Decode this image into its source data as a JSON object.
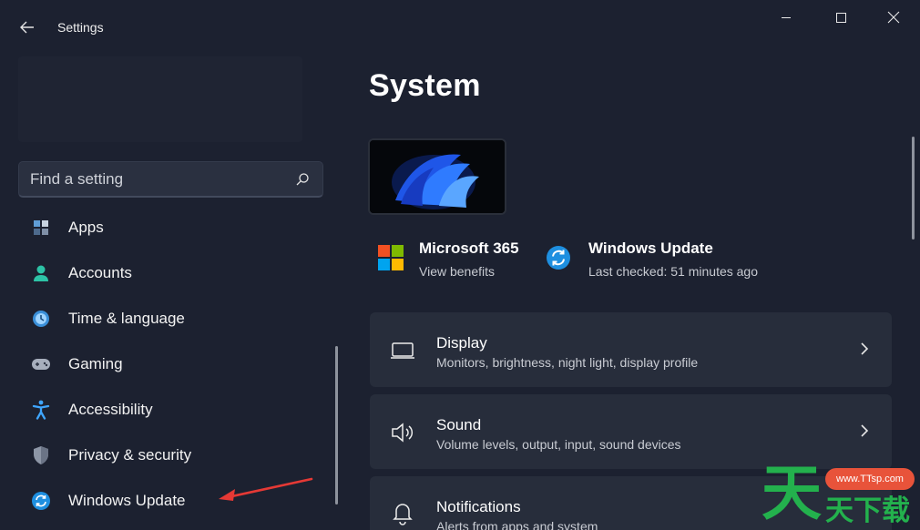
{
  "window": {
    "title": "Settings"
  },
  "search": {
    "placeholder": "Find a setting"
  },
  "sidebar": {
    "items": [
      {
        "label": "Apps",
        "icon": "apps-icon"
      },
      {
        "label": "Accounts",
        "icon": "accounts-icon"
      },
      {
        "label": "Time & language",
        "icon": "time-language-icon"
      },
      {
        "label": "Gaming",
        "icon": "gaming-icon"
      },
      {
        "label": "Accessibility",
        "icon": "accessibility-icon"
      },
      {
        "label": "Privacy & security",
        "icon": "shield-icon"
      },
      {
        "label": "Windows Update",
        "icon": "windows-update-icon"
      }
    ]
  },
  "main": {
    "title": "System",
    "tiles": [
      {
        "title": "Microsoft 365",
        "subtitle": "View benefits",
        "icon": "microsoft-logo-icon"
      },
      {
        "title": "Windows Update",
        "subtitle": "Last checked: 51 minutes ago",
        "icon": "windows-update-icon"
      }
    ],
    "cards": [
      {
        "title": "Display",
        "subtitle": "Monitors, brightness, night light, display profile",
        "icon": "display-icon"
      },
      {
        "title": "Sound",
        "subtitle": "Volume levels, output, input, sound devices",
        "icon": "speaker-icon"
      },
      {
        "title": "Notifications",
        "subtitle": "Alerts from apps and system",
        "icon": "bell-icon"
      }
    ]
  },
  "watermark": {
    "badge": "www.TTsp.com",
    "big": "天",
    "small": "天下载"
  },
  "colors": {
    "background": "#1c2130",
    "card": "#272d3b",
    "accent": "#4cc2ff",
    "arrow": "#e53935",
    "watermark_green": "#23b14d",
    "watermark_badge": "#e8533a"
  }
}
